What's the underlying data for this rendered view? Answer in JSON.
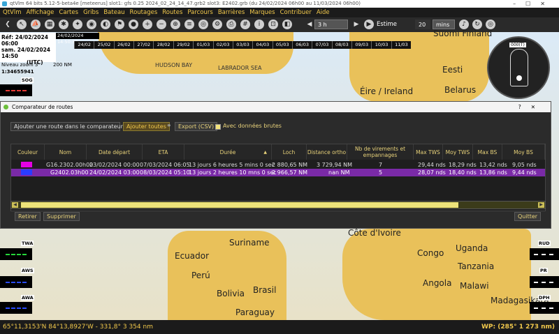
{
  "window": {
    "title": "qtVlm 64 bits 5.12-5-beta4e [meteerus] slot1: gfs 0.25 2024_02_24_14_47.grb2 slot3: E2402.grb (du 24/02/2024 06h00 au 11/03/2024 06h00)"
  },
  "menu": [
    "QtVlm",
    "Affichage",
    "Cartes",
    "Gribs",
    "Bateau",
    "Routages",
    "Routes",
    "Parcours",
    "Barrières",
    "Marques",
    "Contribuer",
    "Aide"
  ],
  "toolbar": {
    "step_value": "3 h",
    "estimate_label": "Estime",
    "estimate_value": "20",
    "estimate_unit": "mins"
  },
  "left_info": {
    "ref_line": "Réf: 24/02/2024 06:00",
    "date_line": "sam. 24/02/2024 14:50",
    "tz": "(UTC)",
    "zoom": "Niveau zoom 3",
    "scale": "1:34655941",
    "scale_nm": "200 NM"
  },
  "timeline": {
    "cursor_label": "24/02/2024 14:50:33",
    "dates": [
      "24/02",
      "25/02",
      "26/02",
      "27/02",
      "28/02",
      "29/02",
      "01/03",
      "02/03",
      "03/03",
      "04/03",
      "05/03",
      "06/03",
      "07/03",
      "08/03",
      "09/03",
      "10/03",
      "11/03"
    ]
  },
  "map_labels": {
    "hudson": "HUDSON BAY",
    "labrador": "LABRADOR SEA",
    "eire": "Éire / Ireland",
    "estonia": "Eesti",
    "belarus": "Belarus",
    "finland": "Suomi Finland",
    "suriname": "Suriname",
    "ecuador": "Ecuador",
    "peru": "Perú",
    "bolivia": "Bolivia",
    "brasil": "Brasil",
    "paraguay": "Paraguay",
    "cote": "Côte d'Ivoire",
    "congo": "Congo",
    "uganda": "Uganda",
    "tanzania": "Tanzania",
    "angola": "Angola",
    "malawi": "Malawi",
    "madagasikara": "Madagasikara"
  },
  "side_labels": {
    "sog": "SOG",
    "twa": "TWA",
    "aws": "AWS",
    "awa": "AWA",
    "rud": "RUD",
    "pr": "PR",
    "dph": "DPH"
  },
  "compass": {
    "heading_box": "000(T)"
  },
  "dialog": {
    "title": "Comparateur de routes",
    "add_combo": "Ajouter une route dans le comparateur",
    "add_all": "Ajouter toutes",
    "export": "Export (CSV)",
    "raw_label": "Avec données brutes",
    "columns": [
      "Couleur",
      "Nom",
      "Date départ",
      "ETA",
      "Durée",
      "Loch",
      "Distance ortho",
      "Nb de virements et empannages",
      "Max TWS",
      "Moy TWS",
      "Max BS",
      "Moy BS"
    ],
    "rows": [
      {
        "color": "#e400e4",
        "name": "G16.2302.00h00",
        "depart": "23/02/2024 00:00",
        "eta": "07/03/2024 06:05",
        "duree": "13 jours 6 heures 5 mins 0 sec",
        "loch": "2 880,65 NM",
        "ortho": "3 729,94 NM",
        "nb": "7",
        "max_tws": "29,44 nds",
        "moy_tws": "18,29 nds",
        "max_bs": "13,42 nds",
        "moy_bs": "9,05 nds"
      },
      {
        "color": "#2a3cff",
        "name": "G2402.03h00",
        "depart": "24/02/2024 03:00",
        "eta": "08/03/2024 05:10",
        "duree": "13 jours 2 heures 10 mns 0 sec",
        "loch": "2 966,57 NM",
        "ortho": "nan NM",
        "nb": "5",
        "max_tws": "28,07 nds",
        "moy_tws": "18,40 nds",
        "max_bs": "13,86 nds",
        "moy_bs": "9,44 nds"
      }
    ],
    "remove": "Retirer",
    "delete": "Supprimer",
    "quit": "Quitter"
  },
  "status": {
    "position": "65°11,3153'N 84°13,8927'W - 331,8° 3 354 nm",
    "wp": "WP: (285° 1 273 nm)"
  },
  "colors": {
    "accent": "#f2c94c",
    "selection": "#7a2aa7",
    "land": "#e9c15a"
  }
}
